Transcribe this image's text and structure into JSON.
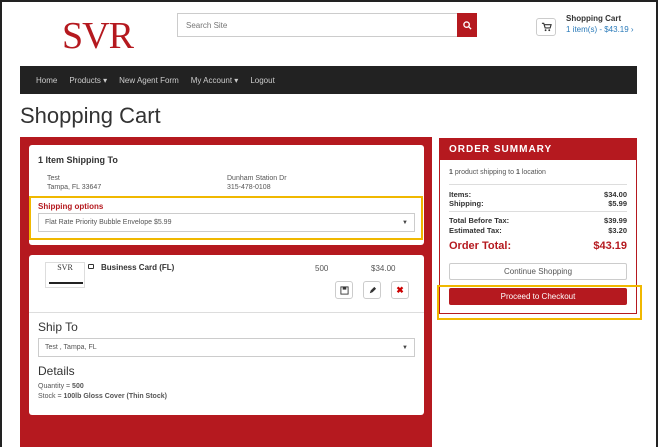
{
  "header": {
    "logo": "SVR",
    "search_placeholder": "Search Site",
    "cart_title": "Shopping Cart",
    "cart_summary": "1 item(s) - $43.19 ›"
  },
  "nav": {
    "items": [
      "Home",
      "Products ▾",
      "New Agent Form",
      "My Account ▾",
      "Logout"
    ]
  },
  "page_title": "Shopping Cart",
  "shipping": {
    "heading": "1 Item Shipping To",
    "name": "Test",
    "city": "Tampa, FL 33647",
    "street": "Dunham Station Dr",
    "phone": "315-478-0108",
    "options_label": "Shipping options",
    "selected_option": "Flat Rate Priority Bubble Envelope $5.99"
  },
  "item": {
    "thumb_logo": "SVR",
    "name": "Business Card (FL)",
    "quantity": "500",
    "price": "$34.00"
  },
  "ship_to": {
    "heading": "Ship To",
    "selected": "Test , Tampa, FL"
  },
  "details": {
    "heading": "Details",
    "quantity_label": "Quantity = ",
    "quantity_value": "500",
    "stock_label": "Stock = ",
    "stock_value": "100lb Gloss Cover (Thin Stock)"
  },
  "summary": {
    "heading": "ORDER SUMMARY",
    "count": "1",
    "shipping_text_a": " product shipping to ",
    "locations": "1",
    "shipping_text_b": " location",
    "items_label": "Items:",
    "items_value": "$34.00",
    "shipping_label": "Shipping:",
    "shipping_value": "$5.99",
    "before_tax_label": "Total Before Tax:",
    "before_tax_value": "$39.99",
    "tax_label": "Estimated Tax:",
    "tax_value": "$3.20",
    "total_label": "Order Total:",
    "total_value": "$43.19",
    "continue_label": "Continue Shopping",
    "checkout_label": "Proceed to Checkout"
  },
  "colors": {
    "brand": "#b5191f",
    "highlight": "#f0b800",
    "nav": "#222222",
    "link": "#2a7ab9"
  }
}
